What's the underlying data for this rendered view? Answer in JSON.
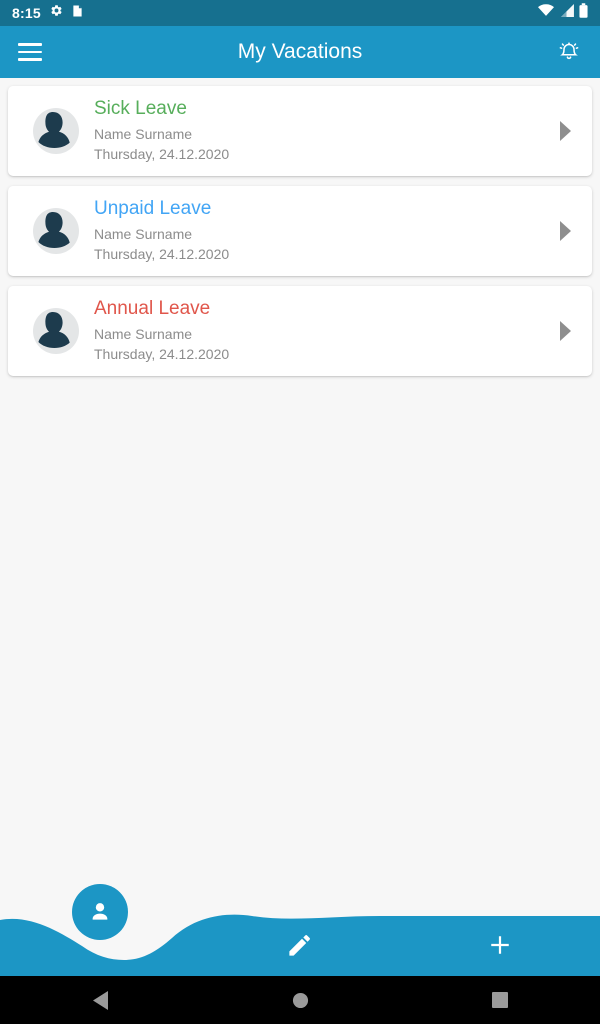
{
  "statusbar": {
    "time": "8:15",
    "icons": [
      "gear-icon",
      "clipboard-icon"
    ],
    "right_icons": [
      "wifi-icon",
      "cellular-signal-icon",
      "battery-icon"
    ]
  },
  "appbar": {
    "menu_icon": "hamburger-menu-icon",
    "title": "My Vacations",
    "notification_icon": "notification-bell-icon"
  },
  "colors": {
    "status_bar": "#16708f",
    "app_bar": "#1c96c5",
    "accent": "#1c96c5",
    "page_background": "#f7f7f7",
    "card_background": "#ffffff",
    "sick_leave": "#57ae5b",
    "unpaid_leave": "#42a5f5",
    "annual_leave": "#e0564b",
    "secondary_text": "#8c8c8c",
    "chevron": "#8e8e8e",
    "avatar_silhouette": "#1d3b4d",
    "avatar_backdrop": "#e4e6e7"
  },
  "list": {
    "items": [
      {
        "title": "Sick Leave",
        "color": "#57ae5b",
        "name": "Name Surname",
        "date": "Thursday, 24.12.2020",
        "avatar_icon": "user-avatar-icon",
        "chevron_icon": "chevron-right-icon"
      },
      {
        "title": "Unpaid Leave",
        "color": "#42a5f5",
        "name": "Name Surname",
        "date": "Thursday, 24.12.2020",
        "avatar_icon": "user-avatar-icon",
        "chevron_icon": "chevron-right-icon"
      },
      {
        "title": "Annual Leave",
        "color": "#e0564b",
        "name": "Name Surname",
        "date": "Thursday, 24.12.2020",
        "avatar_icon": "user-avatar-icon",
        "chevron_icon": "chevron-right-icon"
      }
    ]
  },
  "bottombar": {
    "profile_icon": "person-icon",
    "edit_icon": "pencil-edit-icon",
    "add_icon": "plus-icon"
  },
  "navbar": {
    "back_icon": "back-triangle-icon",
    "home_icon": "home-circle-icon",
    "recents_icon": "recents-square-icon"
  }
}
